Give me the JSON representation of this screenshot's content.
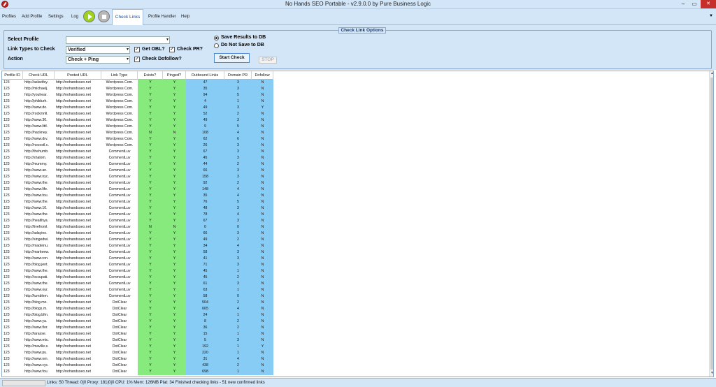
{
  "window": {
    "title": "No Hands SEO Portable - v2.9.0.0 by Pure Business Logic",
    "min": "–",
    "max": "▭",
    "close": "✕"
  },
  "menu": {
    "profiles": "Profiles",
    "add_profile": "Add Profile",
    "settings": "Settings",
    "log": "Log",
    "active_tab": "Check Links",
    "profile_handler": "Profile Handler",
    "help": "Help",
    "dropdown": "▼"
  },
  "options": {
    "title": "Check Link Options",
    "select_profile_label": "Select Profile",
    "select_profile_value": "",
    "link_types_label": "Link Types to Check",
    "link_types_value": "Verified",
    "action_label": "Action",
    "action_value": "Check + Ping",
    "get_obl_label": "Get OBL?",
    "get_obl": true,
    "check_pr_label": "Check PR?",
    "check_pr": true,
    "check_dofollow_label": "Check Dofollow?",
    "check_dofollow": true,
    "save_results_label": "Save Results to DB",
    "do_not_save_label": "Do Not Save to DB",
    "save_choice": "save",
    "start_button": "Start Check",
    "stop_button": "STOP"
  },
  "grid": {
    "columns": [
      "Profile ID",
      "Check URL",
      "Posted URL",
      "Link Type",
      "Exists?",
      "Pinged?",
      "Outbound Links",
      "Domain PR",
      "Dofollow"
    ],
    "rows": [
      [
        "123",
        "http://askwifey.",
        "http://nohandsseo.net",
        "Wordpress Com.",
        "Y",
        "Y",
        "47",
        "3",
        "N"
      ],
      [
        "123",
        "http://michaelj.",
        "http://nohandsseo.net",
        "Wordpress Com.",
        "Y",
        "Y",
        "35",
        "3",
        "N"
      ],
      [
        "123",
        "http://youhear.",
        "http://nohandsseo.net",
        "Wordpress Com.",
        "Y",
        "Y",
        "94",
        "5",
        "N"
      ],
      [
        "123",
        "http://phildurh.",
        "http://nohandsseo.net",
        "Wordpress Com.",
        "Y",
        "Y",
        "4",
        "1",
        "N"
      ],
      [
        "123",
        "http://www.do.",
        "http://nohandsseo.net",
        "Wordpress Com.",
        "Y",
        "Y",
        "49",
        "3",
        "Y"
      ],
      [
        "123",
        "http://rockmnll.",
        "http://nohandsseo.net",
        "Wordpress Com.",
        "Y",
        "Y",
        "52",
        "2",
        "N"
      ],
      [
        "123",
        "http://www.30.",
        "http://nohandsseo.net",
        "Wordpress Com.",
        "Y",
        "Y",
        "49",
        "3",
        "N"
      ],
      [
        "123",
        "http://www.littl.",
        "http://nohandsseo.net",
        "Wordpress Com.",
        "Y",
        "Y",
        "9",
        "5",
        "N"
      ],
      [
        "123",
        "http://hackney.",
        "http://nohandsseo.net",
        "Wordpress Com.",
        "N",
        "N",
        "108",
        "4",
        "N"
      ],
      [
        "123",
        "http://www.drv.",
        "http://nohandsseo.net",
        "Wordpress Com.",
        "Y",
        "Y",
        "62",
        "6",
        "N"
      ],
      [
        "123",
        "http://nocostl.c.",
        "http://nohandsseo.net",
        "Wordpress Com.",
        "Y",
        "Y",
        "26",
        "3",
        "N"
      ],
      [
        "123",
        "http://thehumb.",
        "http://nohandsseo.net",
        "CommentLuv",
        "Y",
        "Y",
        "67",
        "3",
        "N"
      ],
      [
        "123",
        "http://shalom.",
        "http://nohandsseo.net",
        "CommentLuv",
        "Y",
        "Y",
        "45",
        "3",
        "N"
      ],
      [
        "123",
        "http://mummy.",
        "http://nohandsseo.net",
        "CommentLuv",
        "Y",
        "Y",
        "44",
        "2",
        "N"
      ],
      [
        "123",
        "http://www.an.",
        "http://nohandsseo.net",
        "CommentLuv",
        "Y",
        "Y",
        "66",
        "3",
        "N"
      ],
      [
        "123",
        "http://www.nyc.",
        "http://nohandsseo.net",
        "CommentLuv",
        "Y",
        "Y",
        "158",
        "3",
        "N"
      ],
      [
        "123",
        "http://www.the.",
        "http://nohandsseo.net",
        "CommentLuv",
        "Y",
        "Y",
        "92",
        "2",
        "N"
      ],
      [
        "123",
        "http://www.life.",
        "http://nohandsseo.net",
        "CommentLuv",
        "Y",
        "Y",
        "148",
        "4",
        "N"
      ],
      [
        "123",
        "http://www.tou.",
        "http://nohandsseo.net",
        "CommentLuv",
        "Y",
        "Y",
        "35",
        "4",
        "N"
      ],
      [
        "123",
        "http://www.the.",
        "http://nohandsseo.net",
        "CommentLuv",
        "Y",
        "Y",
        "76",
        "5",
        "N"
      ],
      [
        "123",
        "http://www.10.",
        "http://nohandsseo.net",
        "CommentLuv",
        "Y",
        "Y",
        "48",
        "3",
        "N"
      ],
      [
        "123",
        "http://www.the.",
        "http://nohandsseo.net",
        "CommentLuv",
        "Y",
        "Y",
        "78",
        "4",
        "N"
      ],
      [
        "123",
        "http://healthya.",
        "http://nohandsseo.net",
        "CommentLuv",
        "Y",
        "Y",
        "67",
        "3",
        "N"
      ],
      [
        "123",
        "http://livefroml.",
        "http://nohandsseo.net",
        "CommentLuv",
        "N",
        "N",
        "0",
        "0",
        "N"
      ],
      [
        "123",
        "http://adayino.",
        "http://nohandsseo.net",
        "CommentLuv",
        "Y",
        "Y",
        "66",
        "3",
        "N"
      ],
      [
        "123",
        "http://singedwi.",
        "http://nohandsseo.net",
        "CommentLuv",
        "Y",
        "Y",
        "49",
        "2",
        "N"
      ],
      [
        "123",
        "http://madeinu.",
        "http://nohandsseo.net",
        "CommentLuv",
        "Y",
        "Y",
        "34",
        "4",
        "N"
      ],
      [
        "123",
        "http://markeew.",
        "http://nohandsseo.net",
        "CommentLuv",
        "Y",
        "Y",
        "58",
        "3",
        "N"
      ],
      [
        "123",
        "http://www.ron.",
        "http://nohandsseo.net",
        "CommentLuv",
        "Y",
        "Y",
        "41",
        "3",
        "N"
      ],
      [
        "123",
        "http://blog.jent.",
        "http://nohandsseo.net",
        "CommentLuv",
        "Y",
        "Y",
        "71",
        "3",
        "N"
      ],
      [
        "123",
        "http://www.the.",
        "http://nohandsseo.net",
        "CommentLuv",
        "Y",
        "Y",
        "45",
        "1",
        "N"
      ],
      [
        "123",
        "http://occupati.",
        "http://nohandsseo.net",
        "CommentLuv",
        "Y",
        "Y",
        "45",
        "2",
        "N"
      ],
      [
        "123",
        "http://www.the.",
        "http://nohandsseo.net",
        "CommentLuv",
        "Y",
        "Y",
        "61",
        "3",
        "N"
      ],
      [
        "123",
        "http://www.our.",
        "http://nohandsseo.net",
        "CommentLuv",
        "Y",
        "Y",
        "63",
        "1",
        "N"
      ],
      [
        "123",
        "http://tumblem.",
        "http://nohandsseo.net",
        "CommentLuv",
        "Y",
        "Y",
        "58",
        "0",
        "N"
      ],
      [
        "123",
        "http://blog.mo.",
        "http://nohandsseo.net",
        "DotClear",
        "Y",
        "Y",
        "504",
        "2",
        "N"
      ],
      [
        "123",
        "http://blogs.m.",
        "http://nohandsseo.net",
        "DotClear",
        "Y",
        "Y",
        "665",
        "4",
        "N"
      ],
      [
        "123",
        "http://blog.bfm.",
        "http://nohandsseo.net",
        "DotClear",
        "Y",
        "Y",
        "24",
        "1",
        "N"
      ],
      [
        "123",
        "http://www.ya.",
        "http://nohandsseo.net",
        "DotClear",
        "Y",
        "Y",
        "8",
        "2",
        "N"
      ],
      [
        "123",
        "http://www.flor.",
        "http://nohandsseo.net",
        "DotClear",
        "Y",
        "Y",
        "36",
        "2",
        "N"
      ],
      [
        "123",
        "http://larasse.",
        "http://nohandsseo.net",
        "DotClear",
        "Y",
        "Y",
        "15",
        "1",
        "N"
      ],
      [
        "123",
        "http://www.mic.",
        "http://nohandsseo.net",
        "DotClear",
        "Y",
        "Y",
        "5",
        "3",
        "N"
      ],
      [
        "123",
        "http://maville.s.",
        "http://nohandsseo.net",
        "DotClear",
        "Y",
        "Y",
        "192",
        "1",
        "Y"
      ],
      [
        "123",
        "http://www.pu.",
        "http://nohandsseo.net",
        "DotClear",
        "Y",
        "Y",
        "220",
        "1",
        "N"
      ],
      [
        "123",
        "http://www.nm.",
        "http://nohandsseo.net",
        "DotClear",
        "Y",
        "Y",
        "31",
        "4",
        "N"
      ],
      [
        "123",
        "http://www.cyc.",
        "http://nohandsseo.net",
        "DotClear",
        "Y",
        "Y",
        "438",
        "2",
        "N"
      ],
      [
        "123",
        "http://www.fou.",
        "http://nohandsseo.net",
        "DotClear",
        "Y",
        "Y",
        "698",
        "1",
        "N"
      ]
    ]
  },
  "status": {
    "text": "Links: 50  Thread: 0|0  Proxy: 181|0|0  CPU: 1%  Mem: 126MB  Plat: 34  Finished checking links - 51 new confirmed links"
  },
  "colors": {
    "title_bg": "#d3e6f8",
    "exists_col": "#86ea7d",
    "info_col": "#87ccf5",
    "close": "#c5302b"
  }
}
